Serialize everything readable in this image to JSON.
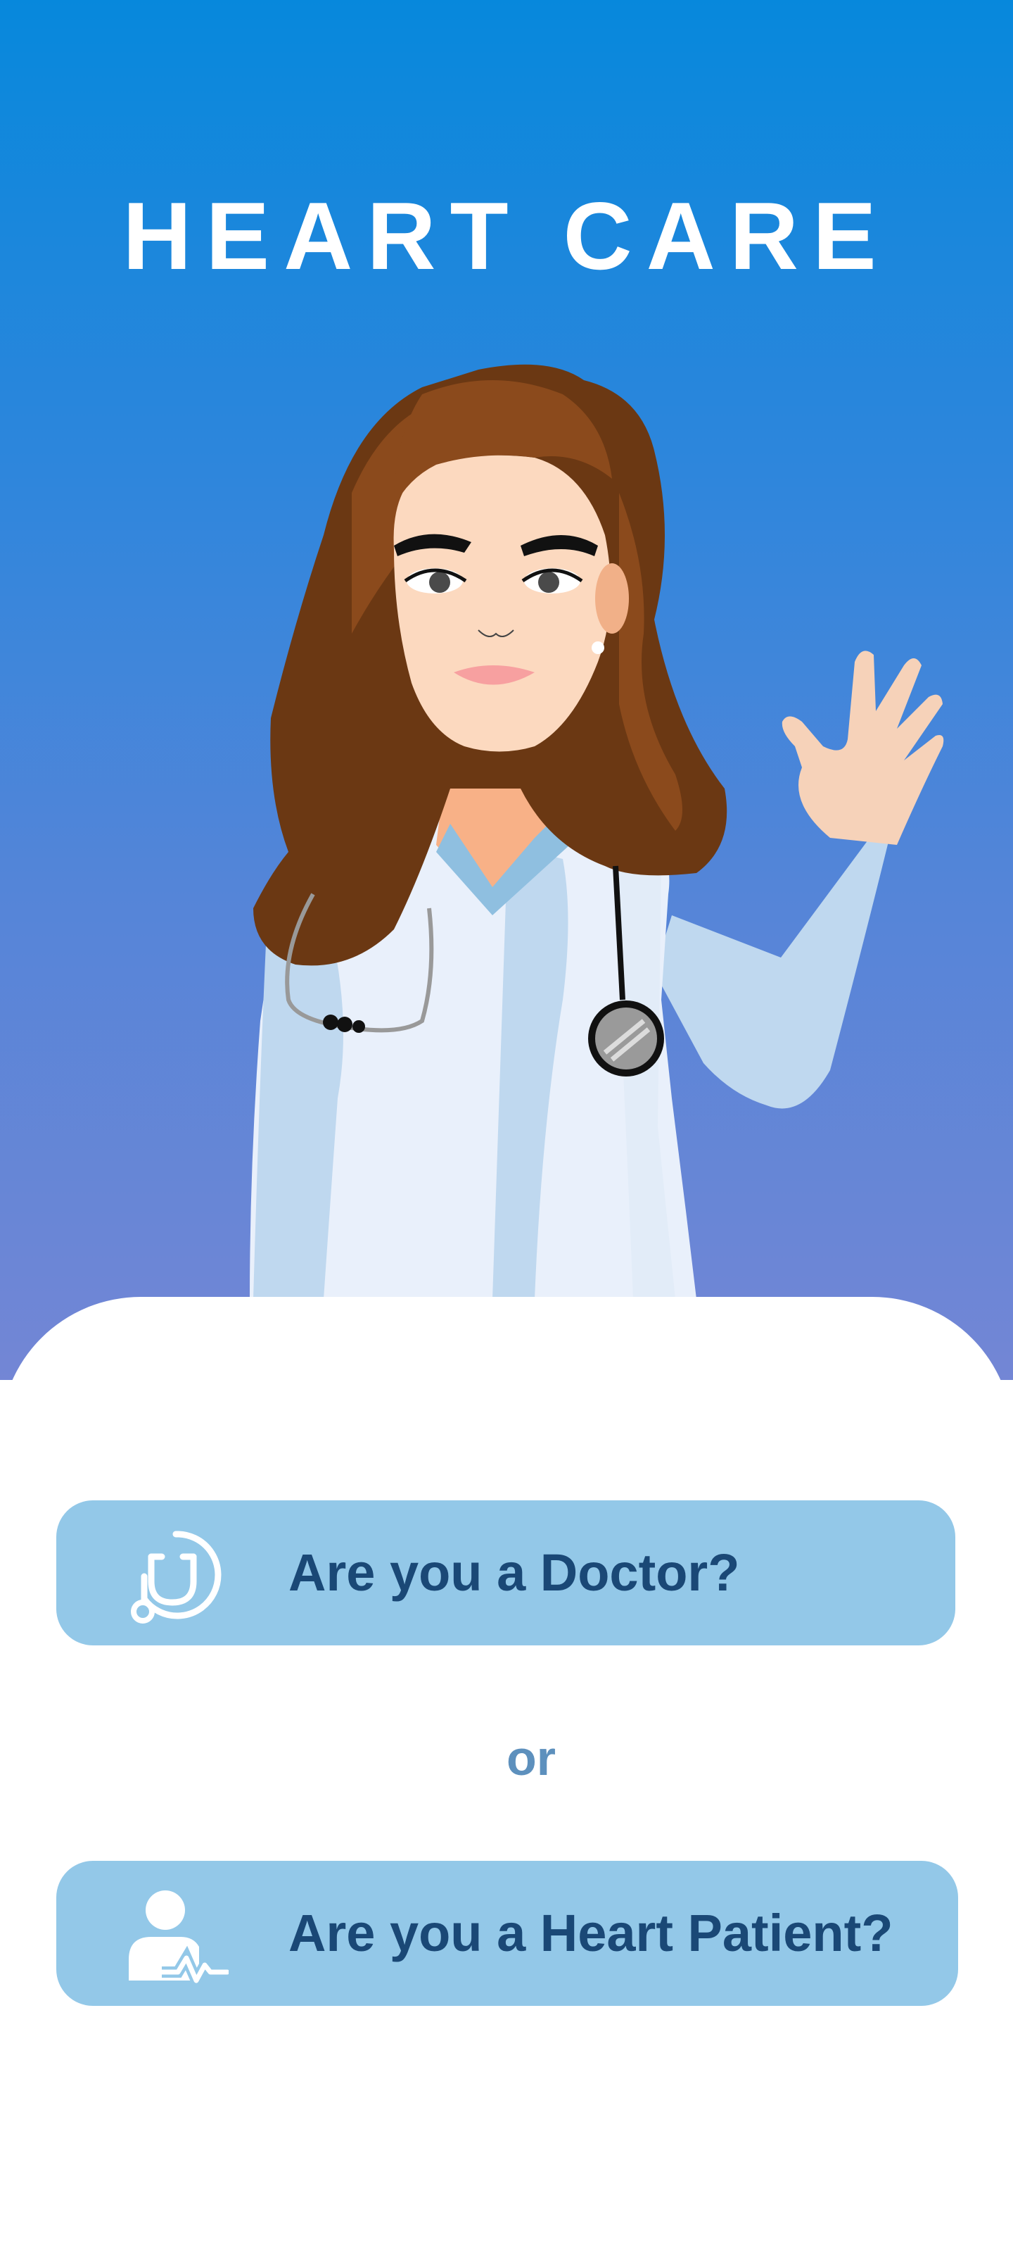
{
  "app": {
    "title": "HEART CARE"
  },
  "role_select": {
    "doctor_label": "Are you a Doctor?",
    "separator": "or",
    "patient_label": "Are you a Heart Patient?"
  },
  "icons": {
    "doctor": "stethoscope-icon",
    "patient": "patient-heartbeat-icon",
    "illustration": "waving-doctor"
  },
  "colors": {
    "gradient_top": "#0788dc",
    "gradient_bottom": "#7386d5",
    "button_bg": "#93c8e8",
    "button_text": "#1a4876",
    "separator_text": "#5d90bd",
    "title_text": "#ffffff"
  }
}
